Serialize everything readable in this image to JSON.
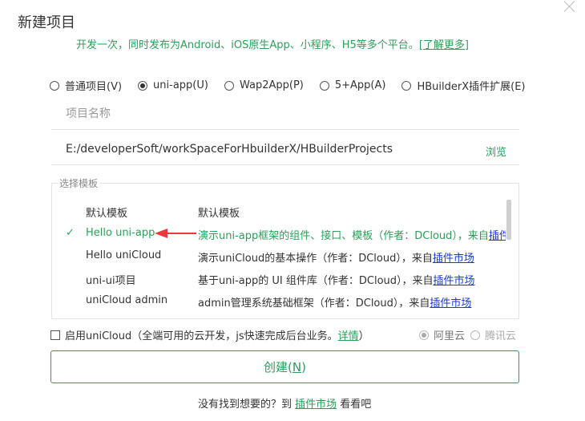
{
  "dialog": {
    "title": "新建项目",
    "subtitle": "开发一次，同时发布为Android、iOS原生App、小程序、H5等多个平台。",
    "learn_more": "[了解更多]"
  },
  "project_types": [
    {
      "label": "普通项目(V)",
      "checked": false
    },
    {
      "label": "uni-app(U)",
      "checked": true
    },
    {
      "label": "Wap2App(P)",
      "checked": false
    },
    {
      "label": "5+App(A)",
      "checked": false
    },
    {
      "label": "HBuilderX插件扩展(E)",
      "checked": false
    }
  ],
  "project_name": {
    "placeholder": "项目名称",
    "value": ""
  },
  "project_path": {
    "value": "E:/developerSoft/workSpaceForHbuilderX/HBuilderProjects",
    "browse_label": "浏览"
  },
  "templates": {
    "legend": "选择模板",
    "items": [
      {
        "name": "默认模板",
        "desc": "默认模板",
        "selected": false,
        "market": ""
      },
      {
        "name": "Hello uni-app",
        "desc": "演示uni-app框架的组件、接口、模板（作者：DCloud），来自",
        "selected": true,
        "market": "插件市场"
      },
      {
        "name": "Hello uniCloud",
        "desc": "演示uniCloud的基本操作（作者：DCloud），来自",
        "selected": false,
        "market": "插件市场"
      },
      {
        "name": "uni-ui项目",
        "desc": "基于uni-app的 UI 组件库（作者：DCloud），来自",
        "selected": false,
        "market": "插件市场"
      },
      {
        "name": "uniCloud admin",
        "desc": "admin管理系统基础框架（作者：DCloud），来自",
        "selected": false,
        "market": "插件市场"
      }
    ],
    "check_mark": "✓"
  },
  "unicloud": {
    "label": "启用uniCloud（全端可用的云开发，js快速完成后台业务。",
    "details": "详情",
    "close_paren": "）",
    "enabled": false,
    "providers": [
      {
        "label": "阿里云",
        "checked": true
      },
      {
        "label": "腾讯云",
        "checked": false
      }
    ]
  },
  "create": {
    "label": "创建(",
    "shortcut": "N",
    "suffix": ")"
  },
  "footer": {
    "prefix": "没有找到想要的？到 ",
    "link": "插件市场",
    "suffix": " 看看吧"
  },
  "colors": {
    "accent": "#2aa05a",
    "arrow": "#e83a3a",
    "link": "#1a3bd8"
  }
}
